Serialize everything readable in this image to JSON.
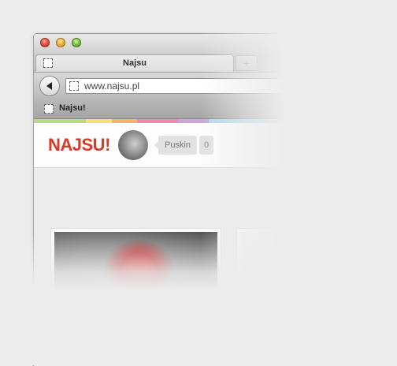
{
  "window": {
    "tab_title": "Najsu",
    "new_tab_glyph": "+",
    "address": "www.najsu.pl",
    "bookmark_label": "Najsu!"
  },
  "stripe_colors": [
    "#b9d98a",
    "#f4e07d",
    "#f7b56c",
    "#ee8aa8",
    "#c9a6d8",
    "#aed9e8"
  ],
  "site": {
    "logo": "NAJSU!",
    "brand_color": "#d83a28",
    "username": "Puskin",
    "count": "0"
  },
  "icons": {
    "back": "back-arrow-icon",
    "favicon": "placeholder-favicon-icon"
  }
}
